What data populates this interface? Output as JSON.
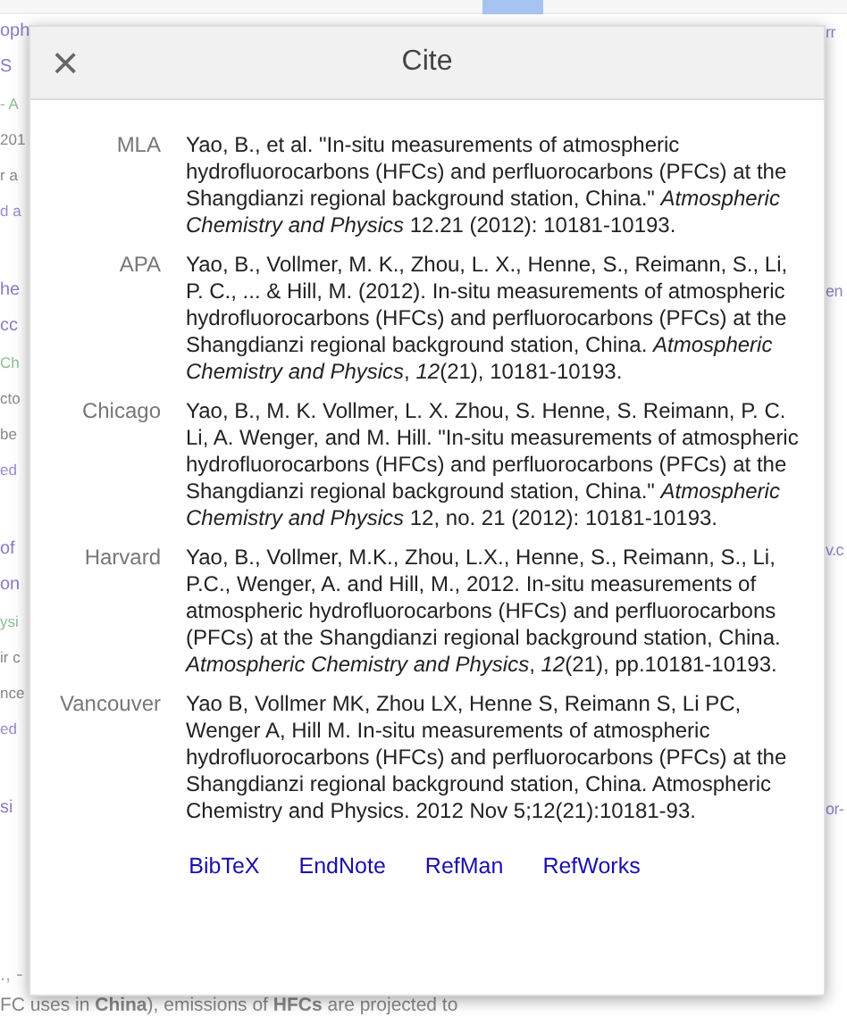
{
  "background": {
    "results": [
      {
        "left": [
          {
            "kind": "title",
            "text": "oph"
          },
          {
            "kind": "title",
            "text": "S"
          },
          {
            "kind": "source",
            "text": "- A"
          },
          {
            "kind": "snippet",
            "text": "201"
          },
          {
            "kind": "snippet",
            "text": "r a"
          },
          {
            "kind": "link",
            "text": "d a"
          }
        ],
        "right": "rr"
      },
      {
        "left": [
          {
            "kind": "title",
            "text": "he"
          },
          {
            "kind": "title",
            "text": "cc"
          },
          {
            "kind": "source",
            "text": "Ch"
          },
          {
            "kind": "snippet",
            "text": "cto"
          },
          {
            "kind": "snippet",
            "text": "be"
          },
          {
            "kind": "link",
            "text": "ed"
          }
        ],
        "right": "en"
      },
      {
        "left": [
          {
            "kind": "title",
            "text": "of"
          },
          {
            "kind": "title",
            "text": "on"
          },
          {
            "kind": "source",
            "text": "ysi"
          },
          {
            "kind": "snippet",
            "text": "ir c"
          },
          {
            "kind": "snippet",
            "text": "nce"
          },
          {
            "kind": "link",
            "text": "ed"
          }
        ],
        "right": "v.c"
      },
      {
        "left": [
          {
            "kind": "title",
            "text": "si"
          }
        ],
        "right": "or-"
      }
    ],
    "footer_fragment": "., -",
    "footer_snippet": "FC uses in **China**), emissions of **HFCs** are projected to"
  },
  "dialog": {
    "title": "Cite",
    "close": "×",
    "citations": [
      {
        "style": "MLA",
        "text": "Yao, B., et al. \"In-situ measurements of atmospheric hydrofluorocarbons (HFCs) and perfluorocarbons (PFCs) at the Shangdianzi regional background station, China.\" *Atmospheric Chemistry and Physics* 12.21 (2012): 10181-10193."
      },
      {
        "style": "APA",
        "text": "Yao, B., Vollmer, M. K., Zhou, L. X., Henne, S., Reimann, S., Li, P. C., ... & Hill, M. (2012). In-situ measurements of atmospheric hydrofluorocarbons (HFCs) and perfluorocarbons (PFCs) at the Shangdianzi regional background station, China. *Atmospheric Chemistry and Physics*, *12*(21), 10181-10193."
      },
      {
        "style": "Chicago",
        "text": "Yao, B., M. K. Vollmer, L. X. Zhou, S. Henne, S. Reimann, P. C. Li, A. Wenger, and M. Hill. \"In-situ measurements of atmospheric hydrofluorocarbons (HFCs) and perfluorocarbons (PFCs) at the Shangdianzi regional background station, China.\" *Atmospheric Chemistry and Physics* 12, no. 21 (2012): 10181-10193."
      },
      {
        "style": "Harvard",
        "text": "Yao, B., Vollmer, M.K., Zhou, L.X., Henne, S., Reimann, S., Li, P.C., Wenger, A. and Hill, M., 2012. In-situ measurements of atmospheric hydrofluorocarbons (HFCs) and perfluorocarbons (PFCs) at the Shangdianzi regional background station, China. *Atmospheric Chemistry and Physics*, *12*(21), pp.10181-10193."
      },
      {
        "style": "Vancouver",
        "text": "Yao B, Vollmer MK, Zhou LX, Henne S, Reimann S, Li PC, Wenger A, Hill M. In-situ measurements of atmospheric hydrofluorocarbons (HFCs) and perfluorocarbons (PFCs) at the Shangdianzi regional background station, China. Atmospheric Chemistry and Physics. 2012 Nov 5;12(21):10181-93."
      }
    ],
    "exports": [
      "BibTeX",
      "EndNote",
      "RefMan",
      "RefWorks"
    ]
  }
}
